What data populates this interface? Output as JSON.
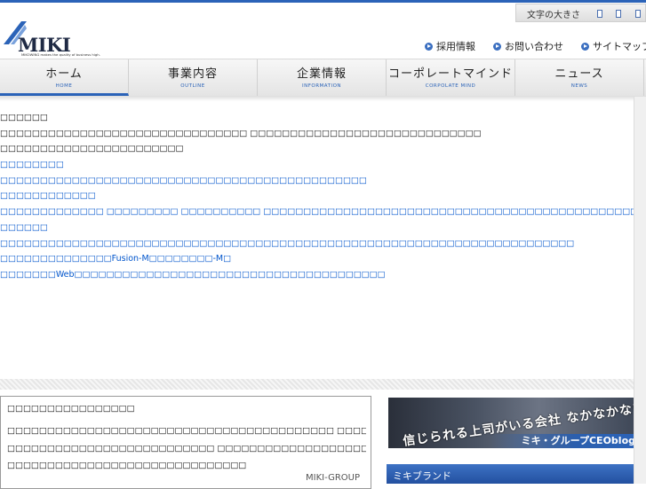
{
  "header": {
    "font_size_label": "文字の大きさ",
    "logo_text": "MIKI GROUP",
    "logo_tagline": "MIKOWING makes the quality of business high.",
    "links": [
      "採用情報",
      "お問い合わせ",
      "サイトマップ"
    ]
  },
  "nav": {
    "items": [
      {
        "label": "ホーム",
        "sub": "HOME"
      },
      {
        "label": "事業内容",
        "sub": "OUTLINE"
      },
      {
        "label": "企業情報",
        "sub": "INFORMATION"
      },
      {
        "label": "コーポレートマインド",
        "sub": "CORPOLATE MIND"
      },
      {
        "label": "ニュース",
        "sub": "NEWS"
      }
    ]
  },
  "content": {
    "lines": [
      "□□□□□□",
      "□□□□□□□□□□□□□□□□□□□□□□□□□□□□□□□ □□□□□□□□□□□□□□□□□□□□□□□□□□□□□",
      "□□□□□□□□□□□□□□□□□□□□□□□",
      "□□□□□□□□",
      "□□□□□□□□□□□□□□□□□□□□□□□□□□□□□□□□□□□□□□□□□□□□□□",
      "□□□□□□□□□□□□",
      "□□□□□□□□□□□□□ □□□□□□□□□ □□□□□□□□□□ □□□□□□□□□□□□□□□□□□□□□□□□□□□□□□□□□□□□□□□□□□□□□□□□□□",
      "□□□□□□",
      "□□□□□□□□□□□□□□□□□□□□□□□□□□□□□□□□□□□□□□□□□□□□□□□□□□□□□□□□□□□□□□□□□□□□□□□□",
      "□□□□□□□□□□□□□□Fusion-M□□□□□□□□-M□",
      "□□□□□□□Web□□□□□□□□□□□□□□□□□□□□□□□□□□□□□□□□□□□□□□□"
    ]
  },
  "news": {
    "title": "□□□□□□□□□□□□□□□□",
    "lines": [
      "□□□□□□□□□□□□□□□□□□□□□□□□□□□□□□□□□□□□□□□□□ □□□□□□□□□□□□□□□□□□□□□□",
      "□□□□□□□□□□□□□□□□□□□□□□□□□□ □□□□□□□□□□□□□□□□□□□□□□□□□□□□□□□□□□□□",
      "□□□□□□□□□□□□□□□□□□□□□□□□□□□□□□"
    ],
    "sign": "MIKI-GROUP"
  },
  "sidebar": {
    "banner_text": "信じられる上司がいる会社 なかなかないから、ぼくがつくろうと思った。",
    "banner_label": "ミキ・グループCEOblog",
    "brand_label": "ミキブランド"
  },
  "colors": {
    "accent": "#2b63b8",
    "link": "#0055cc"
  }
}
